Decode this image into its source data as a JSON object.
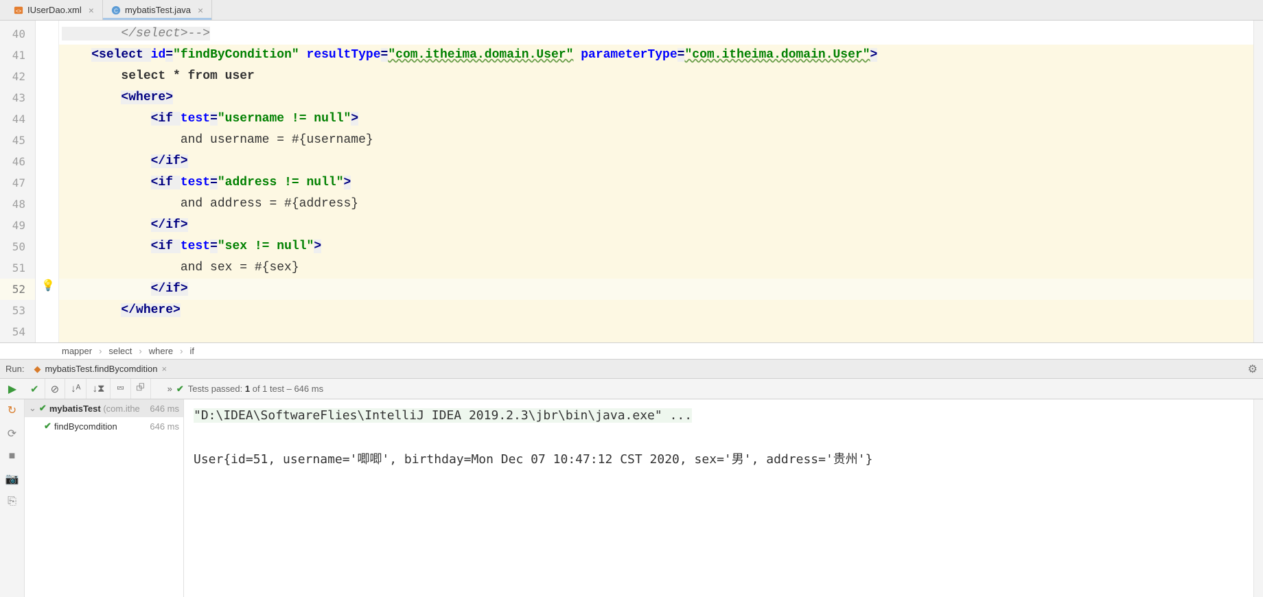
{
  "tabs": [
    {
      "label": "IUserDao.xml"
    },
    {
      "label": "mybatisTest.java"
    }
  ],
  "gutter": {
    "start": 40,
    "end": 54,
    "current": 52
  },
  "code": {
    "l40": "        </select>-->",
    "l41_indent": "    ",
    "l41_tag_open": "<select ",
    "l41_a1": "id",
    "l41_v1": "\"findByCondition\"",
    "l41_a2": "resultType",
    "l41_v2": "\"com.itheima.domain.User\"",
    "l41_a3": "parameterType",
    "l41_v3": "\"com.itheima.domain.User\"",
    "l41_tag_close": ">",
    "l42": "        select * from user",
    "l43_indent": "        ",
    "l43_tag": "<where>",
    "l44_indent": "            ",
    "l44_tag_open": "<if ",
    "l44_attr": "test",
    "l44_val": "\"username != null\"",
    "l44_tag_close": ">",
    "l45": "                and username = #{username}",
    "l46_indent": "            ",
    "l46_tag": "</if>",
    "l47_indent": "            ",
    "l47_tag_open": "<if ",
    "l47_attr": "test",
    "l47_val": "\"address != null\"",
    "l47_tag_close": ">",
    "l48": "                and address = #{address}",
    "l49_indent": "            ",
    "l49_tag": "</if>",
    "l50_indent": "            ",
    "l50_tag_open": "<if ",
    "l50_attr": "test",
    "l50_val": "\"sex != null\"",
    "l50_tag_close": ">",
    "l51": "                and sex = #{sex}",
    "l52_indent": "            ",
    "l52_tag": "</if>",
    "l53_indent": "        ",
    "l53_tag": "</where>",
    "l54": ""
  },
  "breadcrumb": [
    "mapper",
    "select",
    "where",
    "if"
  ],
  "run": {
    "label": "Run:",
    "tab": "mybatisTest.findBycomdition",
    "status_prefix": "Tests passed: ",
    "status_count": "1",
    "status_mid": " of 1 test",
    "status_time": " – 646 ms",
    "tree_root": "mybatisTest",
    "tree_root_dim": " (com.ithe",
    "tree_root_time": "646 ms",
    "tree_child": "findBycomdition",
    "tree_child_time": "646 ms",
    "console_cmd": "\"D:\\IDEA\\SoftwareFlies\\IntelliJ IDEA 2019.2.3\\jbr\\bin\\java.exe\" ...",
    "console_out": "User{id=51, username='唧唧', birthday=Mon Dec 07 10:47:12 CST 2020, sex='男', address='贵州'}"
  }
}
